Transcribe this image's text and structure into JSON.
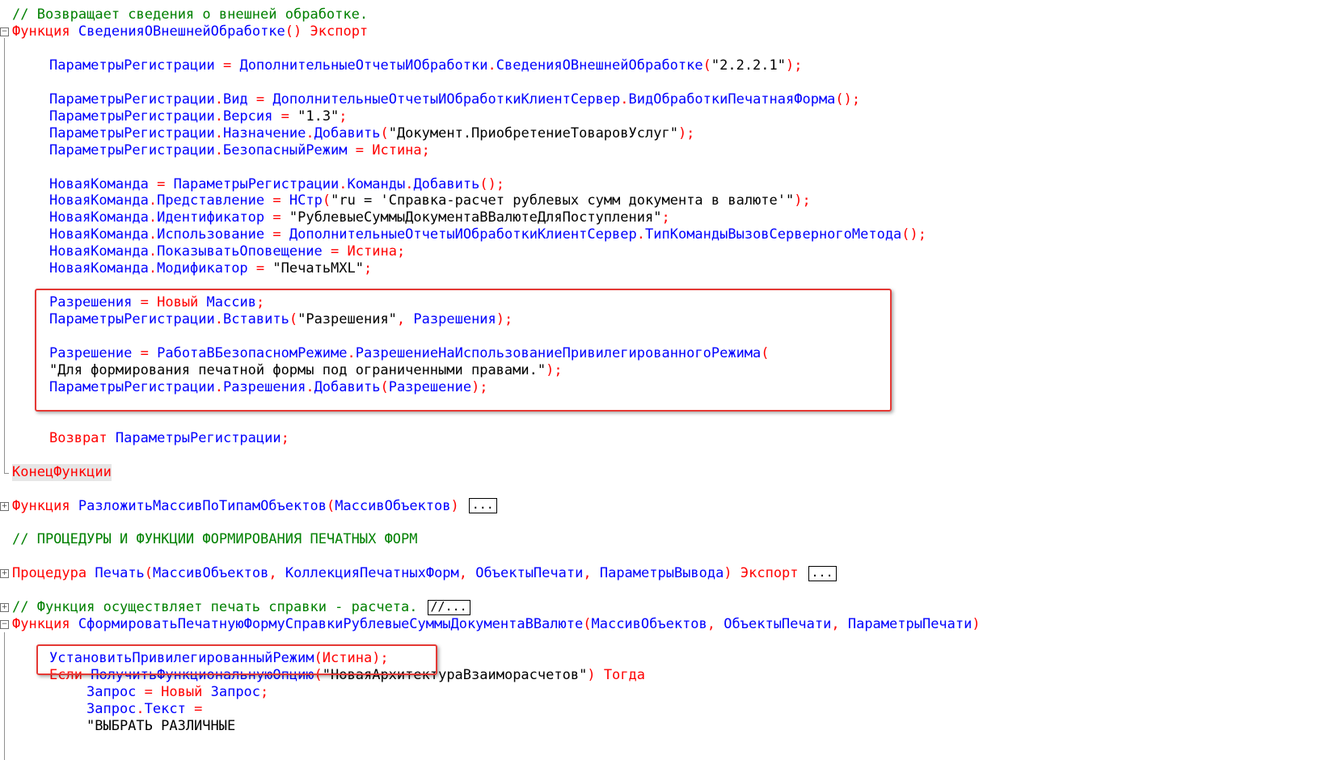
{
  "editor": {
    "lines": [
      {
        "indent": 1,
        "segs": [
          [
            "c",
            "// Возвращает сведения о внешней обработке."
          ]
        ]
      },
      {
        "indent": 1,
        "fold": "open",
        "segs": [
          [
            "k",
            "Функция"
          ],
          [
            "s",
            " "
          ],
          [
            "id",
            "СведенияОВнешнейОбработке"
          ],
          [
            "op",
            "()"
          ],
          [
            "s",
            " "
          ],
          [
            "k",
            "Экспорт"
          ]
        ]
      },
      {
        "indent": 1,
        "segs": []
      },
      {
        "indent": 5,
        "segs": [
          [
            "id",
            "ПараметрыРегистрации"
          ],
          [
            "s",
            " "
          ],
          [
            "op",
            "="
          ],
          [
            "s",
            " "
          ],
          [
            "id",
            "ДополнительныеОтчетыИОбработки"
          ],
          [
            "op",
            "."
          ],
          [
            "id",
            "СведенияОВнешнейОбработке"
          ],
          [
            "op",
            "("
          ],
          [
            "s",
            "\"2.2.2.1\""
          ],
          [
            "op",
            ");"
          ]
        ]
      },
      {
        "indent": 1,
        "segs": []
      },
      {
        "indent": 5,
        "segs": [
          [
            "id",
            "ПараметрыРегистрации"
          ],
          [
            "op",
            "."
          ],
          [
            "id",
            "Вид"
          ],
          [
            "s",
            " "
          ],
          [
            "op",
            "="
          ],
          [
            "s",
            " "
          ],
          [
            "id",
            "ДополнительныеОтчетыИОбработкиКлиентСервер"
          ],
          [
            "op",
            "."
          ],
          [
            "id",
            "ВидОбработкиПечатнаяФорма"
          ],
          [
            "op",
            "();"
          ]
        ]
      },
      {
        "indent": 5,
        "segs": [
          [
            "id",
            "ПараметрыРегистрации"
          ],
          [
            "op",
            "."
          ],
          [
            "id",
            "Версия"
          ],
          [
            "s",
            " "
          ],
          [
            "op",
            "="
          ],
          [
            "s",
            " \"1.3\""
          ],
          [
            "op",
            ";"
          ]
        ]
      },
      {
        "indent": 5,
        "segs": [
          [
            "id",
            "ПараметрыРегистрации"
          ],
          [
            "op",
            "."
          ],
          [
            "id",
            "Назначение"
          ],
          [
            "op",
            "."
          ],
          [
            "id",
            "Добавить"
          ],
          [
            "op",
            "("
          ],
          [
            "s",
            "\"Документ.ПриобретениеТоваровУслуг\""
          ],
          [
            "op",
            ");"
          ]
        ]
      },
      {
        "indent": 5,
        "segs": [
          [
            "id",
            "ПараметрыРегистрации"
          ],
          [
            "op",
            "."
          ],
          [
            "id",
            "БезопасныйРежим"
          ],
          [
            "s",
            " "
          ],
          [
            "op",
            "="
          ],
          [
            "s",
            " "
          ],
          [
            "k",
            "Истина"
          ],
          [
            "op",
            ";"
          ]
        ]
      },
      {
        "indent": 1,
        "segs": []
      },
      {
        "indent": 5,
        "segs": [
          [
            "id",
            "НоваяКоманда"
          ],
          [
            "s",
            " "
          ],
          [
            "op",
            "="
          ],
          [
            "s",
            " "
          ],
          [
            "id",
            "ПараметрыРегистрации"
          ],
          [
            "op",
            "."
          ],
          [
            "id",
            "Команды"
          ],
          [
            "op",
            "."
          ],
          [
            "id",
            "Добавить"
          ],
          [
            "op",
            "();"
          ]
        ]
      },
      {
        "indent": 5,
        "segs": [
          [
            "id",
            "НоваяКоманда"
          ],
          [
            "op",
            "."
          ],
          [
            "id",
            "Представление"
          ],
          [
            "s",
            " "
          ],
          [
            "op",
            "="
          ],
          [
            "s",
            " "
          ],
          [
            "id",
            "НСтр"
          ],
          [
            "op",
            "("
          ],
          [
            "s",
            "\"ru = 'Справка-расчет рублевых сумм документа в валюте'\""
          ],
          [
            "op",
            ");"
          ]
        ]
      },
      {
        "indent": 5,
        "segs": [
          [
            "id",
            "НоваяКоманда"
          ],
          [
            "op",
            "."
          ],
          [
            "id",
            "Идентификатор"
          ],
          [
            "s",
            " "
          ],
          [
            "op",
            "="
          ],
          [
            "s",
            " \"РублевыеСуммыДокументаВВалютеДляПоступления\""
          ],
          [
            "op",
            ";"
          ]
        ]
      },
      {
        "indent": 5,
        "segs": [
          [
            "id",
            "НоваяКоманда"
          ],
          [
            "op",
            "."
          ],
          [
            "id",
            "Использование"
          ],
          [
            "s",
            " "
          ],
          [
            "op",
            "="
          ],
          [
            "s",
            " "
          ],
          [
            "id",
            "ДополнительныеОтчетыИОбработкиКлиентСервер"
          ],
          [
            "op",
            "."
          ],
          [
            "id",
            "ТипКомандыВызовСерверногоМетода"
          ],
          [
            "op",
            "();"
          ]
        ]
      },
      {
        "indent": 5,
        "segs": [
          [
            "id",
            "НоваяКоманда"
          ],
          [
            "op",
            "."
          ],
          [
            "id",
            "ПоказыватьОповещение"
          ],
          [
            "s",
            " "
          ],
          [
            "op",
            "="
          ],
          [
            "s",
            " "
          ],
          [
            "k",
            "Истина"
          ],
          [
            "op",
            ";"
          ]
        ]
      },
      {
        "indent": 5,
        "segs": [
          [
            "id",
            "НоваяКоманда"
          ],
          [
            "op",
            "."
          ],
          [
            "id",
            "Модификатор"
          ],
          [
            "s",
            " "
          ],
          [
            "op",
            "="
          ],
          [
            "s",
            " \"ПечатьMXL\""
          ],
          [
            "op",
            ";"
          ]
        ]
      },
      {
        "indent": 1,
        "segs": []
      },
      {
        "indent": 5,
        "segs": [
          [
            "id",
            "Разрешения"
          ],
          [
            "s",
            " "
          ],
          [
            "op",
            "="
          ],
          [
            "s",
            " "
          ],
          [
            "k",
            "Новый"
          ],
          [
            "s",
            " "
          ],
          [
            "id",
            "Массив"
          ],
          [
            "op",
            ";"
          ]
        ]
      },
      {
        "indent": 5,
        "segs": [
          [
            "id",
            "ПараметрыРегистрации"
          ],
          [
            "op",
            "."
          ],
          [
            "id",
            "Вставить"
          ],
          [
            "op",
            "("
          ],
          [
            "s",
            "\"Разрешения\""
          ],
          [
            "op",
            ","
          ],
          [
            "s",
            " "
          ],
          [
            "id",
            "Разрешения"
          ],
          [
            "op",
            ");"
          ]
        ]
      },
      {
        "indent": 1,
        "segs": []
      },
      {
        "indent": 5,
        "segs": [
          [
            "id",
            "Разрешение"
          ],
          [
            "s",
            " "
          ],
          [
            "op",
            "="
          ],
          [
            "s",
            " "
          ],
          [
            "id",
            "РаботаВБезопасномРежиме"
          ],
          [
            "op",
            "."
          ],
          [
            "id",
            "РазрешениеНаИспользованиеПривилегированногоРежима"
          ],
          [
            "op",
            "("
          ]
        ]
      },
      {
        "indent": 5,
        "segs": [
          [
            "s",
            "\"Для формирования печатной формы под ограниченными правами.\""
          ],
          [
            "op",
            ");"
          ]
        ]
      },
      {
        "indent": 5,
        "segs": [
          [
            "id",
            "ПараметрыРегистрации"
          ],
          [
            "op",
            "."
          ],
          [
            "id",
            "Разрешения"
          ],
          [
            "op",
            "."
          ],
          [
            "id",
            "Добавить"
          ],
          [
            "op",
            "("
          ],
          [
            "id",
            "Разрешение"
          ],
          [
            "op",
            ");"
          ]
        ]
      },
      {
        "indent": 1,
        "segs": []
      },
      {
        "indent": 1,
        "segs": []
      },
      {
        "indent": 5,
        "segs": [
          [
            "k",
            "Возврат"
          ],
          [
            "s",
            " "
          ],
          [
            "id",
            "ПараметрыРегистрации"
          ],
          [
            "op",
            ";"
          ]
        ]
      },
      {
        "indent": 1,
        "segs": []
      },
      {
        "indent": 1,
        "hl": true,
        "segs": [
          [
            "k",
            "КонецФункции"
          ]
        ]
      },
      {
        "indent": 1,
        "segs": []
      },
      {
        "indent": 1,
        "fold": "closed",
        "segs": [
          [
            "k",
            "Функция"
          ],
          [
            "s",
            " "
          ],
          [
            "id",
            "РазложитьМассивПоТипамОбъектов"
          ],
          [
            "op",
            "("
          ],
          [
            "id",
            "МассивОбъектов"
          ],
          [
            "op",
            ")"
          ]
        ],
        "collapsed": "..."
      },
      {
        "indent": 1,
        "segs": []
      },
      {
        "indent": 1,
        "segs": [
          [
            "c",
            "// ПРОЦЕДУРЫ И ФУНКЦИИ ФОРМИРОВАНИЯ ПЕЧАТНЫХ ФОРМ"
          ]
        ]
      },
      {
        "indent": 1,
        "segs": []
      },
      {
        "indent": 1,
        "fold": "closed",
        "segs": [
          [
            "k",
            "Процедура"
          ],
          [
            "s",
            " "
          ],
          [
            "id",
            "Печать"
          ],
          [
            "op",
            "("
          ],
          [
            "id",
            "МассивОбъектов"
          ],
          [
            "op",
            ","
          ],
          [
            "s",
            " "
          ],
          [
            "id",
            "КоллекцияПечатныхФорм"
          ],
          [
            "op",
            ","
          ],
          [
            "s",
            " "
          ],
          [
            "id",
            "ОбъектыПечати"
          ],
          [
            "op",
            ","
          ],
          [
            "s",
            " "
          ],
          [
            "id",
            "ПараметрыВывода"
          ],
          [
            "op",
            ")"
          ],
          [
            "s",
            " "
          ],
          [
            "k",
            "Экспорт"
          ]
        ],
        "collapsed": "..."
      },
      {
        "indent": 1,
        "segs": []
      },
      {
        "indent": 1,
        "fold": "closed",
        "segs": [
          [
            "c",
            "// Функция осуществляет печать справки - расчета."
          ]
        ],
        "collapsed": "//..."
      },
      {
        "indent": 1,
        "fold": "open",
        "segs": [
          [
            "k",
            "Функция"
          ],
          [
            "s",
            " "
          ],
          [
            "id",
            "СформироватьПечатнуюФормуСправкиРублевыеСуммыДокументаВВалюте"
          ],
          [
            "op",
            "("
          ],
          [
            "id",
            "МассивОбъектов"
          ],
          [
            "op",
            ","
          ],
          [
            "s",
            " "
          ],
          [
            "id",
            "ОбъектыПечати"
          ],
          [
            "op",
            ","
          ],
          [
            "s",
            " "
          ],
          [
            "id",
            "ПараметрыПечати"
          ],
          [
            "op",
            ")"
          ]
        ]
      },
      {
        "indent": 1,
        "segs": []
      },
      {
        "indent": 5,
        "segs": [
          [
            "id",
            "УстановитьПривилегированныйРежим"
          ],
          [
            "op",
            "("
          ],
          [
            "k",
            "Истина"
          ],
          [
            "op",
            ");"
          ]
        ]
      },
      {
        "indent": 5,
        "segs": [
          [
            "k",
            "Если"
          ],
          [
            "s",
            " "
          ],
          [
            "id",
            "ПолучитьФункциональнуюОпцию"
          ],
          [
            "op",
            "("
          ],
          [
            "s",
            "\"НоваяАрхитектураВзаиморасчетов\""
          ],
          [
            "op",
            ")"
          ],
          [
            "s",
            " "
          ],
          [
            "k",
            "Тогда"
          ]
        ]
      },
      {
        "indent": 9,
        "segs": [
          [
            "id",
            "Запрос"
          ],
          [
            "s",
            " "
          ],
          [
            "op",
            "="
          ],
          [
            "s",
            " "
          ],
          [
            "k",
            "Новый"
          ],
          [
            "s",
            " "
          ],
          [
            "id",
            "Запрос"
          ],
          [
            "op",
            ";"
          ]
        ]
      },
      {
        "indent": 9,
        "segs": [
          [
            "id",
            "Запрос"
          ],
          [
            "op",
            "."
          ],
          [
            "id",
            "Текст"
          ],
          [
            "s",
            " "
          ],
          [
            "op",
            "="
          ]
        ]
      },
      {
        "indent": 9,
        "segs": [
          [
            "s",
            "\"ВЫБРАТЬ РАЗЛИЧНЫЕ"
          ]
        ]
      }
    ]
  }
}
